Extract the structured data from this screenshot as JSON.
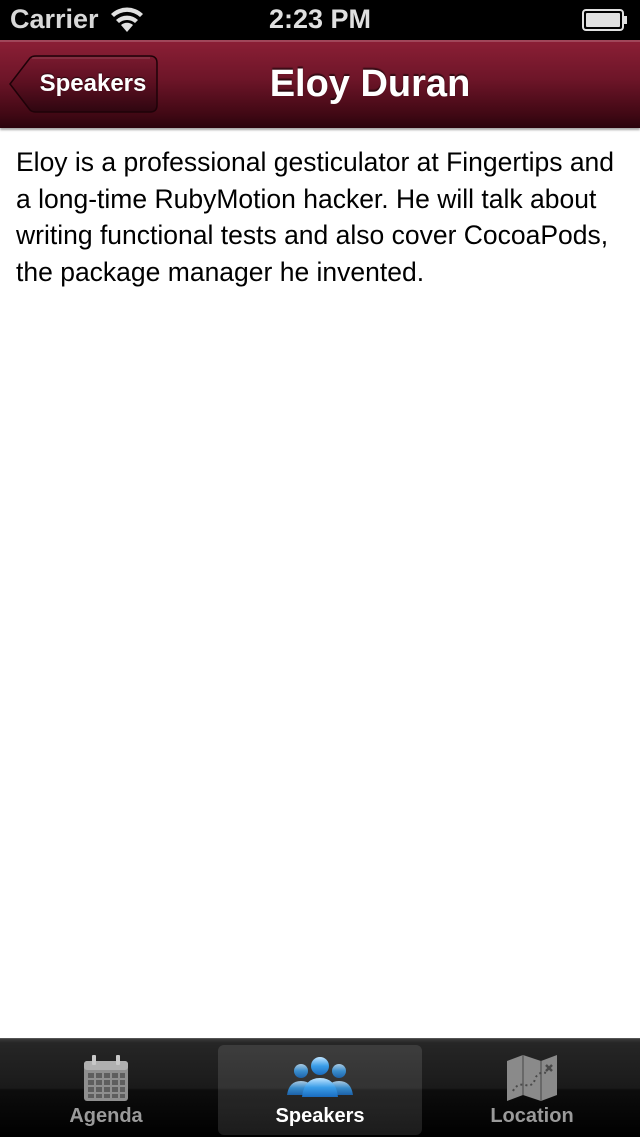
{
  "status_bar": {
    "carrier": "Carrier",
    "time": "2:23 PM",
    "wifi_icon": "wifi-icon",
    "battery_icon": "battery-icon"
  },
  "nav_bar": {
    "back_label": "Speakers",
    "title": "Eloy Duran",
    "colors": {
      "bar_top": "#8c1f36",
      "bar_bottom": "#2a040d"
    }
  },
  "content": {
    "bio": "Eloy is a professional gesticulator at Fingertips and a long-time RubyMotion hacker. He will talk about writing functional tests and also cover CocoaPods, the package manager he invented."
  },
  "tab_bar": {
    "tabs": [
      {
        "label": "Agenda",
        "icon": "calendar-icon",
        "selected": false
      },
      {
        "label": "Speakers",
        "icon": "people-icon",
        "selected": true
      },
      {
        "label": "Location",
        "icon": "map-icon",
        "selected": false
      }
    ]
  }
}
